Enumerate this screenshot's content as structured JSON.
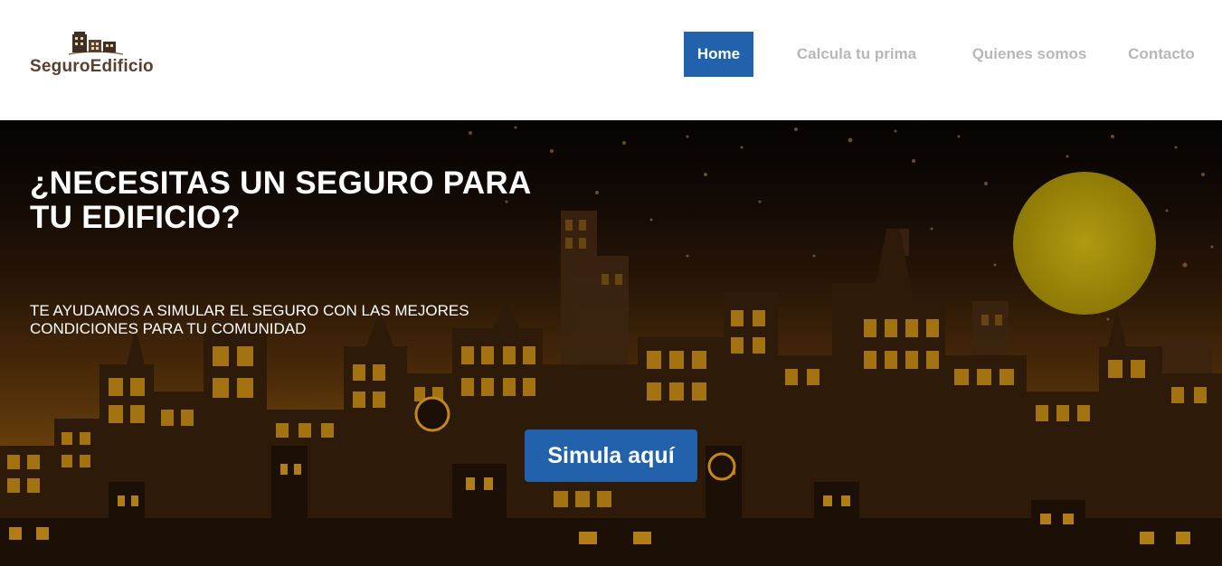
{
  "brand": {
    "name": "SeguroEdificio",
    "colors": {
      "primary": "#2262ad",
      "brand_text": "#5a4030",
      "nav_inactive": "#b8b8b8"
    }
  },
  "nav": {
    "items": [
      {
        "label": "Home",
        "active": true
      },
      {
        "label": "Calcula tu prima",
        "active": false
      },
      {
        "label": "Quienes somos",
        "active": false
      },
      {
        "label": "Contacto",
        "active": false
      }
    ]
  },
  "hero": {
    "title": "¿NECESITAS UN SEGURO PARA TU EDIFICIO?",
    "subtitle": "TE AYUDAMOS A SIMULAR EL SEGURO CON LAS MEJORES CONDICIONES PARA TU COMUNIDAD",
    "cta_label": "Simula aquí",
    "background": "night-city-skyline-illustration"
  }
}
